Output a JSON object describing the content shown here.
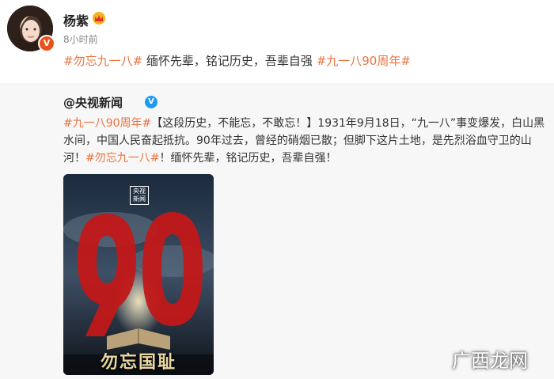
{
  "post": {
    "author": "杨紫",
    "time": "8小时前",
    "hashtag1": "#勿忘九一八#",
    "body": " 缅怀先辈，铭记历史，吾辈自强 ",
    "hashtag2": "#九一八90周年#",
    "verified_badge": "V"
  },
  "repost": {
    "author": "@央视新闻",
    "verified_badge": "V",
    "hashtag1": "#九一八90周年#",
    "body1": "【这段历史，不能忘，不敢忘！】1931年9月18日，“九一八”事变爆发，白山黑水间，中国人民奋起抵抗。90年过去，曾经的硝烟已散；但脚下这片土地，是先烈浴血守卫的山河！",
    "hashtag2": "#勿忘九一八#",
    "body2": "！缅怀先辈，铭记历史，吾辈自强！",
    "poster": {
      "logo_line1": "央视",
      "logo_line2": "新闻",
      "number": "90",
      "slogan": "勿忘国耻"
    }
  },
  "watermark": "广西龙网",
  "icons": {
    "avatar": "avatar-photo",
    "member": "member-crown-icon",
    "verified": "verified-v-icon"
  },
  "colors": {
    "hashtag": "#eb7340",
    "repost_bg": "#f7f7f7",
    "verified_orange": "#e8521b",
    "verified_blue": "#1d9bf0",
    "poster_red": "#c21818"
  }
}
